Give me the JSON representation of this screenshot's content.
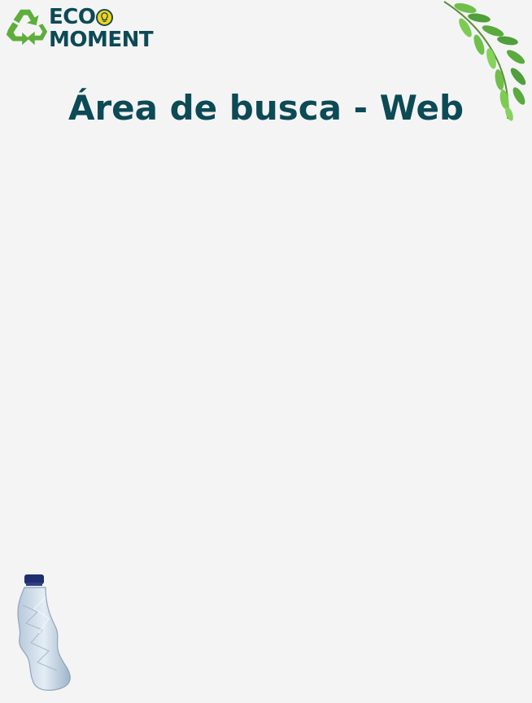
{
  "logo": {
    "line1": "ECO",
    "line2": "MOMENT",
    "icon": "recycle-icon",
    "bulb_icon": "lightbulb-icon"
  },
  "page": {
    "title": "Área de busca - Web"
  },
  "decorations": {
    "leaves": "leaf-branch-illustration",
    "bottle": "crushed-plastic-bottle-illustration"
  },
  "colors": {
    "background": "#f4f4f5",
    "brand_dark": "#0c4a55",
    "recycle_green": "#5eae3c",
    "bulb_yellow": "#f5d21a"
  }
}
